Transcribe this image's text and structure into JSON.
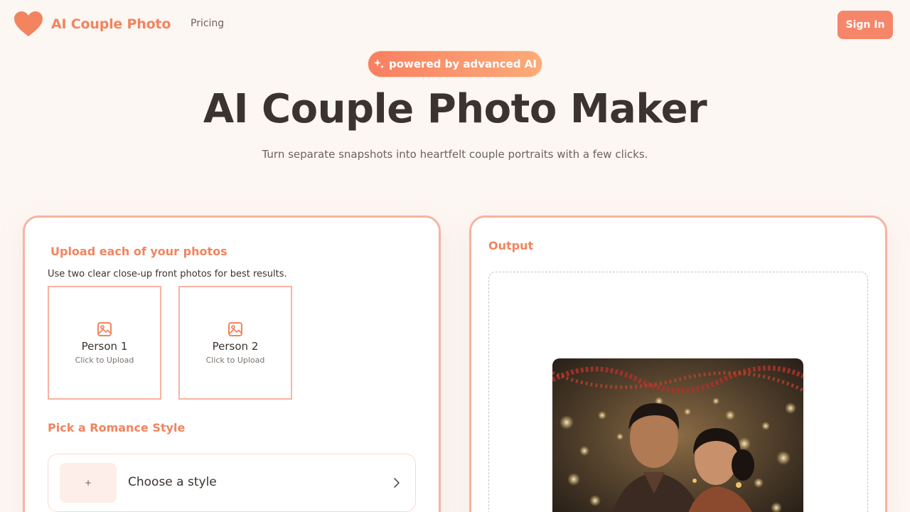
{
  "header": {
    "brand": "AI Couple Photo",
    "logo_icon": "heart-icon",
    "nav": [
      {
        "label": "Pricing"
      }
    ],
    "sign_in": "Sign In"
  },
  "hero": {
    "badge_icon": "sparkle-icon",
    "badge": "powered by advanced AI",
    "title": "AI Couple Photo Maker",
    "subtitle": "Turn separate snapshots into heartfelt couple portraits with a few clicks."
  },
  "upload": {
    "title": "Upload each of your photos",
    "hint": "Use two clear close-up front photos for best results.",
    "slots": [
      {
        "name": "Person 1",
        "action": "Click to Upload",
        "icon": "image-icon"
      },
      {
        "name": "Person 2",
        "action": "Click to Upload",
        "icon": "image-icon"
      }
    ]
  },
  "style": {
    "title": "Pick a Romance Style",
    "thumb_symbol": "+",
    "placeholder": "Choose a style",
    "chevron_icon": "chevron-right-icon"
  },
  "output": {
    "title": "Output"
  },
  "colors": {
    "accent": "#f2845f",
    "button": "#f6866a",
    "card_border": "#f8b3a2",
    "background": "#fdf7f3",
    "text": "#3a332f"
  }
}
